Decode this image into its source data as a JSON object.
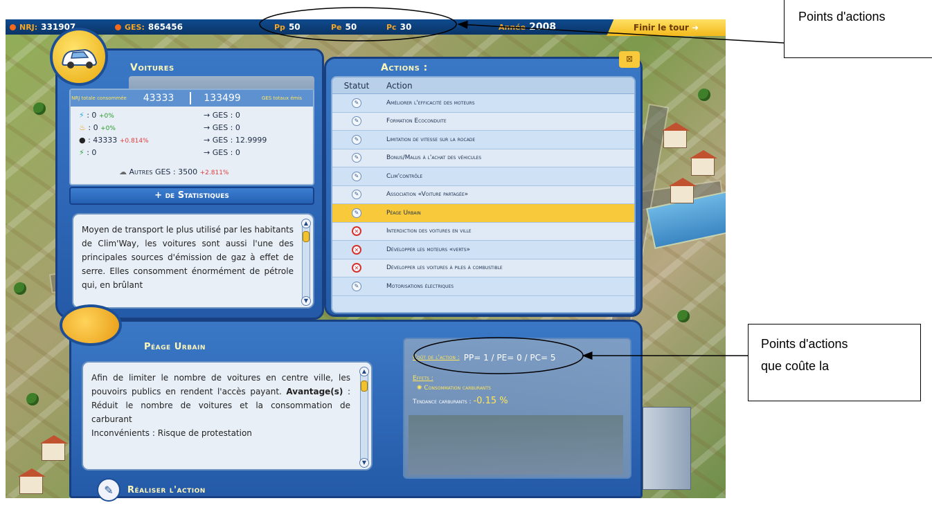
{
  "topbar": {
    "net_label": "NRJ:",
    "net_value": "331907",
    "ges_label": "GES:",
    "ges_value": "865456",
    "pp_label": "Pp",
    "pp_value": "50",
    "pe_label": "Pe",
    "pe_value": "50",
    "pc_label": "Pc",
    "pc_value": "30",
    "year_label": "Année",
    "year_value": "2008",
    "end_turn": "Finir le tour"
  },
  "sector": {
    "title": "Voitures",
    "icon": "car-icon",
    "nrj_total_label": "NRJ totale consommée",
    "nrj_total_value": "43333",
    "ges_total_value": "133499",
    "ges_total_label": "GES totaux émis",
    "rows": [
      {
        "icon": "electricity-icon",
        "value": ": 0",
        "pct": "+0%",
        "ges": "→ GES : 0"
      },
      {
        "icon": "fire-icon",
        "value": ": 0",
        "pct": "+0%",
        "ges": "→ GES : 0"
      },
      {
        "icon": "oil-drop-icon",
        "value": ": 43333",
        "pct": "+0.814%",
        "ges": "→ GES : 12.9999"
      },
      {
        "icon": "green-energy-icon",
        "value": ": 0",
        "pct": "",
        "ges": "→ GES : 0"
      }
    ],
    "other_ges_label": "Autres GES : 3500",
    "other_ges_pct": "+2.811%",
    "more_stats": "+ de Statistiques",
    "description": "Moyen de transport le plus utilisé par les habitants de Clim'Way, les voitures sont aussi l'une des principales sources d'émission de gaz à effet de serre. Elles consomment énormément de pétrole qui, en brûlant"
  },
  "actions": {
    "title": "Actions :",
    "col_status": "Statut",
    "col_action": "Action",
    "items": [
      {
        "label": "Améliorer l'efficacité des moteurs",
        "status": "available"
      },
      {
        "label": "Formation Ecoconduite",
        "status": "available"
      },
      {
        "label": "Limitation de vitesse sur la rocade",
        "status": "available"
      },
      {
        "label": "Bonus/Malus à l'achat des véhicules",
        "status": "available"
      },
      {
        "label": "Clim'contrôle",
        "status": "available"
      },
      {
        "label": "Association «Voiture partagée»",
        "status": "available"
      },
      {
        "label": "Péage Urbain",
        "status": "selected"
      },
      {
        "label": "Interdiction des voitures en ville",
        "status": "locked"
      },
      {
        "label": "Développer les moteurs «verts»",
        "status": "locked"
      },
      {
        "label": "Développer les voitures à piles à combustible",
        "status": "locked"
      },
      {
        "label": "Motorisations électriques",
        "status": "available"
      }
    ]
  },
  "detail": {
    "title": "Péage Urbain",
    "text_1": "Afin de limiter le nombre de voitures en centre ville, les pouvoirs publics en rendent l'accès payant.",
    "advantages_label": "Avantage(s)",
    "advantages_text": " : Réduit le nombre de voitures et la consommation de carburant",
    "inconvenients": "Inconvénients : Risque de protestation",
    "cost_label": "Coût de l'action :",
    "cost_values": "PP= 1 / PE= 0 / PC= 5",
    "effects_label": "Effets :",
    "effect_1": "Consommation carburants",
    "effect_2_label": "Tendance carburants :",
    "effect_2_value": "-0.15 %",
    "do_action": "Réaliser l'action"
  },
  "annotations": {
    "top": "Points d'actions",
    "bottom_line1": "Points d'actions",
    "bottom_line2": "que coûte la"
  },
  "colors": {
    "frame_blue": "#245aa8",
    "selected_row": "#f8c93a",
    "title_yellow": "#fff7b8"
  }
}
